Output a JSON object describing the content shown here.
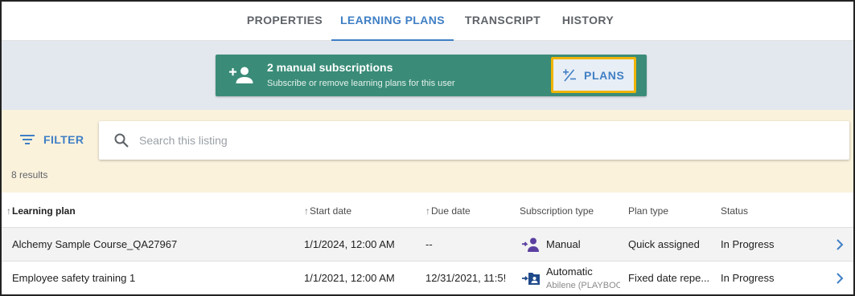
{
  "tabs": [
    {
      "label": "PROPERTIES",
      "active": false
    },
    {
      "label": "LEARNING PLANS",
      "active": true
    },
    {
      "label": "TRANSCRIPT",
      "active": false
    },
    {
      "label": "HISTORY",
      "active": false
    }
  ],
  "banner": {
    "title": "2 manual subscriptions",
    "subtitle": "Subscribe or remove learning plans for this user",
    "button_label": "PLANS",
    "icon": "add-person-icon",
    "color": "#3a8c78",
    "highlight_color": "#f0b400"
  },
  "filter": {
    "label": "FILTER",
    "search_placeholder": "Search this listing",
    "results": "8 results"
  },
  "table": {
    "columns": [
      "Learning plan",
      "Start date",
      "Due date",
      "Subscription type",
      "Plan type",
      "Status"
    ],
    "rows": [
      {
        "learning_plan": "Alchemy Sample Course_QA27967",
        "start_date": "1/1/2024, 12:00 AM",
        "due_date": "--",
        "subscription_type": "Manual",
        "subscription_detail": "",
        "subscription_icon": "person-add-icon",
        "plan_type": "Quick assigned",
        "status": "In Progress"
      },
      {
        "learning_plan": "Employee safety training 1",
        "start_date": "1/1/2021, 12:00 AM",
        "due_date": "12/31/2021, 11:5!",
        "subscription_type": "Automatic",
        "subscription_detail": "Abilene (PLAYBOO",
        "subscription_icon": "folder-login-icon",
        "plan_type": "Fixed date repe...",
        "status": "In Progress"
      }
    ]
  },
  "accent_color": "#3f7fc5"
}
